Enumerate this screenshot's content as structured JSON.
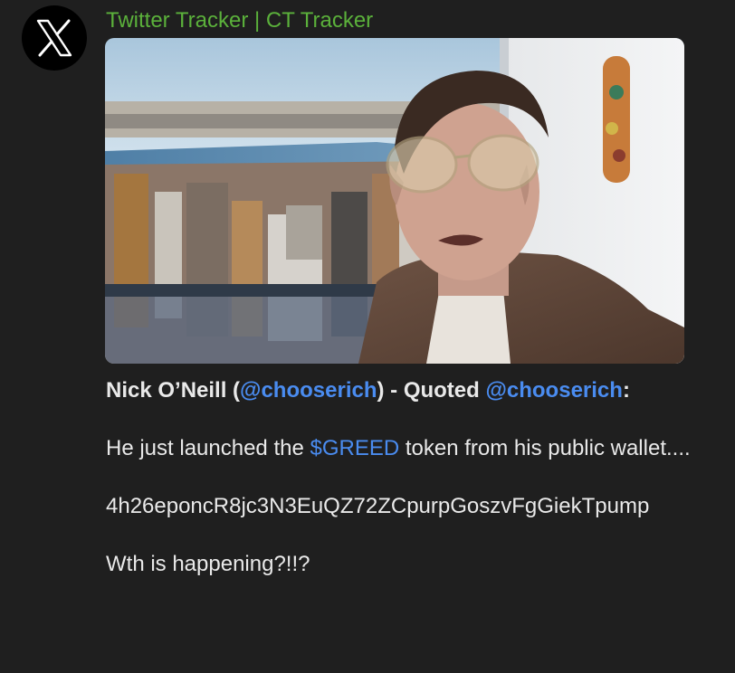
{
  "sender": {
    "name": "Twitter Tracker | CT Tracker",
    "avatar_icon": "x-logo-icon",
    "name_color": "#5bb13b"
  },
  "media": {
    "type": "image",
    "subject": "selfie-video-thumbnail"
  },
  "message": {
    "author_name": "Nick O’Neill (",
    "author_handle": "@chooserich",
    "quoted_prefix": ") - Quoted ",
    "quoted_handle": "@chooserich",
    "header_suffix": ":",
    "line1_before": "He just launched the ",
    "ticker": "$GREED",
    "line1_after": " token from his public wallet....",
    "contract_address": "4h26eponcR8jc3N3EuQZ72ZCpurpGoszvFgGiekTpump",
    "closing_line": "Wth is happening?!!?"
  },
  "colors": {
    "background": "#1f1f1f",
    "text": "#e9e9e9",
    "link": "#4a8cf0"
  }
}
